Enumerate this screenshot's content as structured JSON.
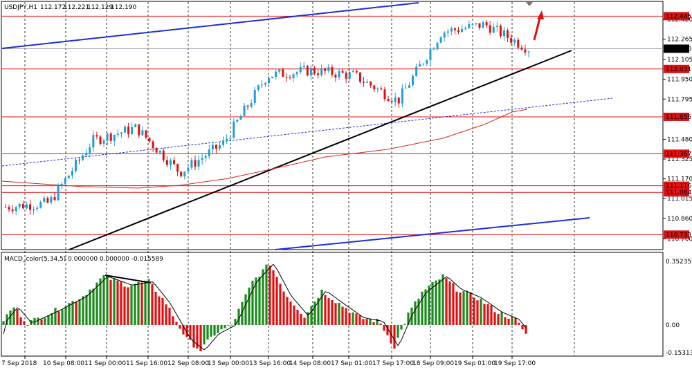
{
  "window": {
    "title": "USDJPY,H1",
    "ohlc": [
      "112.172",
      "112.221",
      "112.129",
      "112.190"
    ]
  },
  "colors": {
    "background": "#ffffff",
    "bull_candle": "#1f9fd4",
    "bear_candle": "#e01010",
    "green_candle": "#3cae3c",
    "level_line": "#e01010",
    "channel_line": "#1c2fd6",
    "trend_line": "#000000",
    "ma_line": "#d42a1a",
    "macd_up": "#1d8a1d",
    "macd_down": "#e01010",
    "signal_line": "#000000",
    "current_price_line": "#a0a0b0"
  },
  "price_axis": {
    "ticks": [
      "112.420",
      "112.265",
      "112.105",
      "111.950",
      "111.795",
      "111.480",
      "111.325",
      "111.170",
      "111.015",
      "110.860",
      "110.700"
    ],
    "level_labels": [
      "112.445",
      "112.031",
      "111.656",
      "111.367",
      "111.116",
      "111.064",
      "110.733"
    ],
    "current_price": "112.190"
  },
  "macd": {
    "header": "MACD_color(5,34,5) 0.000000 0.000000 -0.015589",
    "axis_labels": [
      "0.352359",
      "0.00",
      "-0.15313"
    ]
  },
  "time_axis": {
    "labels": [
      "7 Sep 2018",
      "10 Sep 08:00",
      "11 Sep 00:00",
      "11 Sep 16:00",
      "12 Sep 08:00",
      "13 Sep 00:00",
      "13 Sep 16:00",
      "14 Sep 08:00",
      "17 Sep 01:00",
      "17 Sep 17:00",
      "18 Sep 09:00",
      "19 Sep 01:00",
      "19 Sep 17:00"
    ]
  },
  "chart_data": {
    "type": "candlestick",
    "symbol": "USDJPY",
    "timeframe": "H1",
    "ylim": [
      110.7,
      112.5
    ],
    "horizontal_levels": [
      112.445,
      112.031,
      111.656,
      111.367,
      111.116,
      111.064,
      110.733
    ],
    "close_path": [
      {
        "t": "7 Sep 2018",
        "close": 110.95
      },
      {
        "t": "10 Sep 08:00",
        "close": 110.98
      },
      {
        "t": "11 Sep 00:00",
        "close": 111.47
      },
      {
        "t": "11 Sep 16:00",
        "close": 111.57
      },
      {
        "t": "12 Sep 08:00",
        "close": 111.22
      },
      {
        "t": "13 Sep 00:00",
        "close": 111.45
      },
      {
        "t": "13 Sep 16:00",
        "close": 111.98
      },
      {
        "t": "14 Sep 08:00",
        "close": 112.02
      },
      {
        "t": "17 Sep 01:00",
        "close": 111.98
      },
      {
        "t": "17 Sep 17:00",
        "close": 111.78
      },
      {
        "t": "18 Sep 09:00",
        "close": 112.32
      },
      {
        "t": "19 Sep 01:00",
        "close": 112.38
      },
      {
        "t": "19 Sep 17:00",
        "close": 112.19
      }
    ],
    "macd_range": [
      -0.15313,
      0.352359
    ]
  }
}
